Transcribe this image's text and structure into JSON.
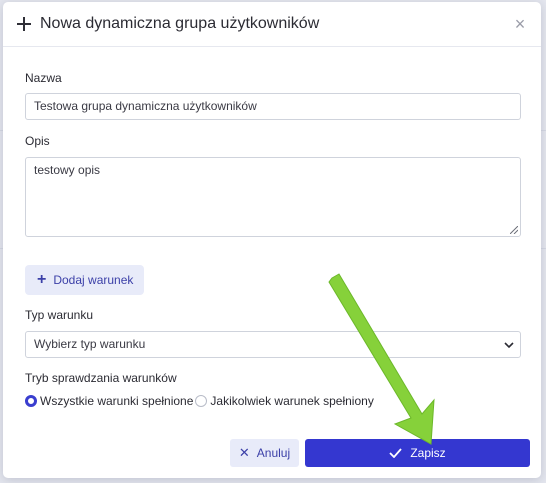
{
  "dialog": {
    "title": "Nowa dynamiczna grupa użytkowników",
    "close_glyph": "×"
  },
  "form": {
    "name_label": "Nazwa",
    "name_value": "Testowa grupa dynamiczna użytkowników",
    "description_label": "Opis",
    "description_value": "testowy opis",
    "add_condition_label": "Dodaj warunek",
    "condition_type_label": "Typ warunku",
    "condition_type_value": "Wybierz typ warunku",
    "check_mode_label": "Tryb sprawdzania warunków",
    "check_mode_options": [
      {
        "label": "Wszystkie warunki spełnione",
        "selected": true
      },
      {
        "label": "Jakikolwiek warunek spełniony",
        "selected": false
      }
    ]
  },
  "footer": {
    "cancel_label": "Anuluj",
    "save_label": "Zapisz"
  },
  "colors": {
    "primary": "#3437d0",
    "secondary_bg": "#e8ebf9",
    "annotation_arrow": "#86d13a"
  },
  "icons": [
    "plus-icon",
    "close-icon",
    "resize-handle-icon",
    "chevron-down-icon",
    "x-icon",
    "check-icon",
    "annotation-arrow"
  ]
}
